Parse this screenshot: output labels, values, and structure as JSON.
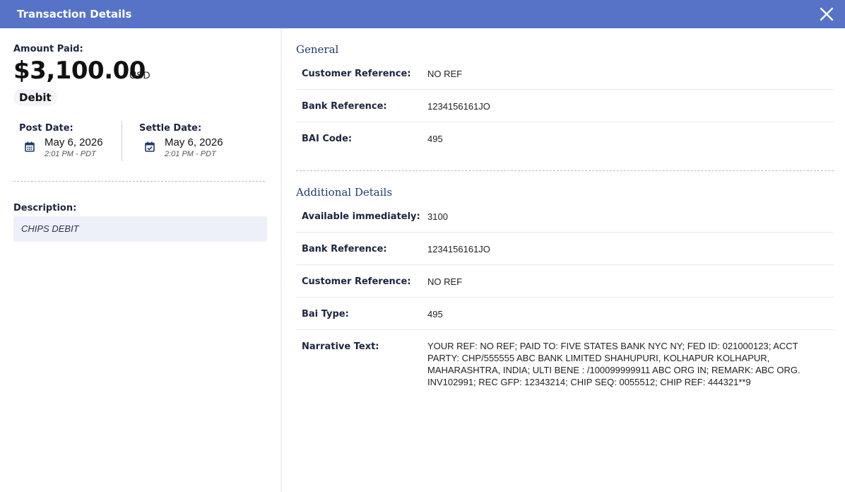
{
  "header": {
    "title": "Transaction Details"
  },
  "summary": {
    "amount_label": "Amount Paid:",
    "amount": "$3,100.00",
    "currency": "USD",
    "type": "Debit",
    "post_date_label": "Post Date:",
    "post_date": "May 6, 2026",
    "post_time": "2:01 PM - PDT",
    "settle_date_label": "Settle Date:",
    "settle_date": "May 6, 2026",
    "settle_time": "2:01 PM - PDT",
    "description_label": "Description:",
    "description": "CHIPS DEBIT"
  },
  "general": {
    "title": "General",
    "rows": [
      {
        "label": "Customer Reference:",
        "value": "NO REF"
      },
      {
        "label": "Bank Reference:",
        "value": "1234156161JO"
      },
      {
        "label": "BAI Code:",
        "value": "495"
      }
    ]
  },
  "additional": {
    "title": "Additional Details",
    "rows": [
      {
        "label": "Available immediately:",
        "value": "3100"
      },
      {
        "label": "Bank Reference:",
        "value": "1234156161JO"
      },
      {
        "label": "Customer Reference:",
        "value": "NO REF"
      },
      {
        "label": "Bai Type:",
        "value": "495"
      },
      {
        "label": "Narrative Text:",
        "value": "YOUR REF: NO REF; PAID TO: FIVE STATES BANK NYC NY; FED ID: 021000123; ACCT PARTY: CHP/555555 ABC BANK LIMITED SHAHUPURI, KOLHAPUR KOLHAPUR, MAHARASHTRA, INDIA; ULTI BENE : /100099999911 ABC ORG IN; REMARK: ABC ORG. INV102991; REC GFP: 12343214; CHIP SEQ: 0055512; CHIP REF: 444321**9"
      }
    ]
  },
  "icons": {
    "close": "close-icon",
    "calendar": "calendar-icon",
    "calendar_check": "calendar-check-icon"
  },
  "colors": {
    "header": "#5673c8",
    "description_bg": "#edf0f8",
    "section_title": "#1f3a6e"
  }
}
